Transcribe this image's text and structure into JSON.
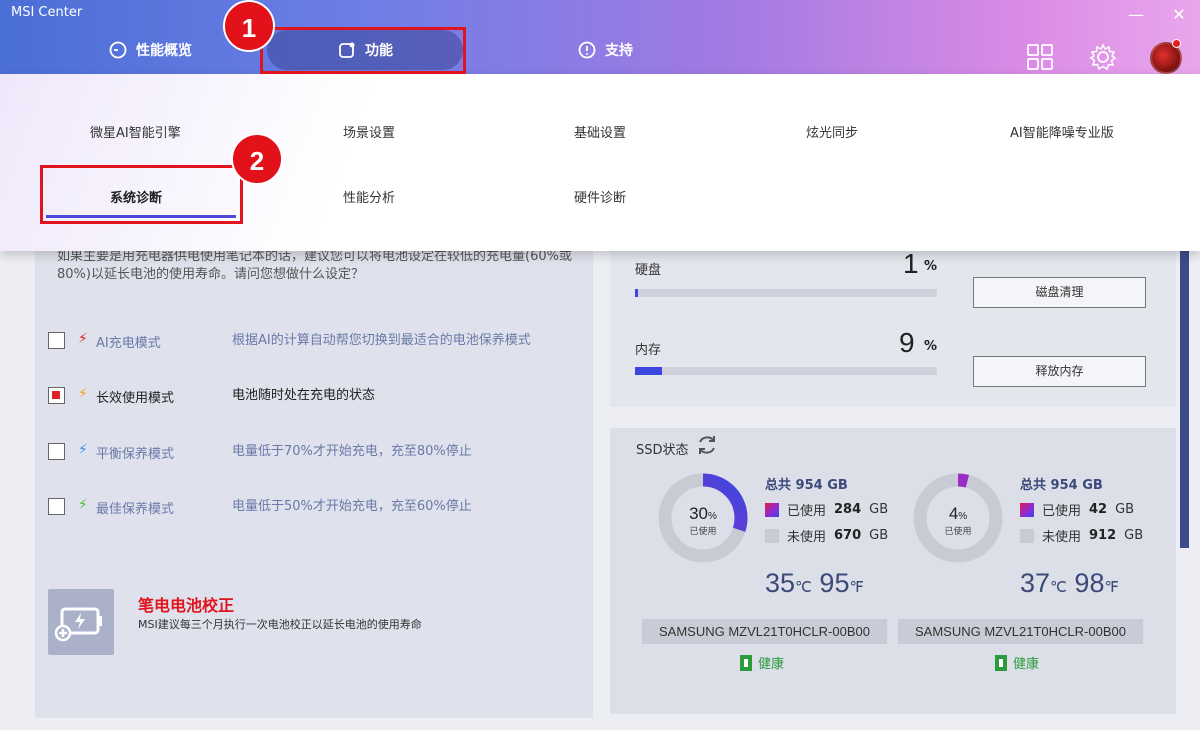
{
  "app": {
    "title": "MSI Center"
  },
  "window": {
    "minimize": "—",
    "close": "✕"
  },
  "nav": {
    "tabs": [
      {
        "label": "性能概览",
        "icon": "performance-gauge-icon"
      },
      {
        "label": "功能",
        "icon": "features-icon",
        "active": true
      },
      {
        "label": "支持",
        "icon": "support-icon"
      }
    ],
    "icons": [
      "grid-icon",
      "gear-icon",
      "avatar"
    ]
  },
  "menu": {
    "row1": [
      "微星AI智能引擎",
      "场景设置",
      "基础设置",
      "炫光同步",
      "AI智能降噪专业版"
    ],
    "row2": [
      "系统诊断",
      "性能分析",
      "硬件诊断"
    ],
    "selected": "系统诊断"
  },
  "callouts": [
    "1",
    "2"
  ],
  "battery": {
    "description": "如果主要是用充电器供电使用笔记本的话，建议您可以将电池设定在较低的充电量(60%或80%)以延长电池的使用寿命。请问您想做什么设定？",
    "options": [
      {
        "label": "AI充电模式",
        "desc": "根据AI的计算自动帮您切换到最适合的电池保养模式",
        "checked": false,
        "bolt_color": "#e0232a"
      },
      {
        "label": "长效使用模式",
        "desc": "电池随时处在充电的状态",
        "checked": true,
        "bolt_color": "#f0a020"
      },
      {
        "label": "平衡保养模式",
        "desc": "电量低于70%才开始充电，充至80%停止",
        "checked": false,
        "bolt_color": "#3a8ee0"
      },
      {
        "label": "最佳保养模式",
        "desc": "电量低于50%才开始充电，充至60%停止",
        "checked": false,
        "bolt_color": "#4cc040"
      }
    ],
    "calibration": {
      "title": "笔电电池校正",
      "desc": "MSI建议每三个月执行一次电池校正以延长电池的使用寿命"
    }
  },
  "resources": {
    "disk": {
      "label": "硬盘",
      "value": "1",
      "unit": "%",
      "percent": 1,
      "button": "磁盘清理"
    },
    "memory": {
      "label": "内存",
      "value": "9",
      "unit": "%",
      "percent": 9,
      "button": "释放内存"
    }
  },
  "ssd": {
    "title": "SSD状态",
    "drives": [
      {
        "percent": "30",
        "percent_unit": "%",
        "percent_label": "已使用",
        "used_fraction": 0.3,
        "total_label": "总共",
        "total": "954 GB",
        "used_label": "已使用",
        "used": "284",
        "used_unit": "GB",
        "free_label": "未使用",
        "free": "670",
        "free_unit": "GB",
        "temp_c": "35",
        "temp_f": "95",
        "unit_c": "℃",
        "unit_f": "℉",
        "model": "SAMSUNG MZVL21T0HCLR-00B00",
        "health": "健康"
      },
      {
        "percent": "4",
        "percent_unit": "%",
        "percent_label": "已使用",
        "used_fraction": 0.04,
        "total_label": "总共",
        "total": "954 GB",
        "used_label": "已使用",
        "used": "42",
        "used_unit": "GB",
        "free_label": "未使用",
        "free": "912",
        "free_unit": "GB",
        "temp_c": "37",
        "temp_f": "98",
        "unit_c": "℃",
        "unit_f": "℉",
        "model": "SAMSUNG MZVL21T0HCLR-00B00",
        "health": "健康"
      }
    ]
  }
}
